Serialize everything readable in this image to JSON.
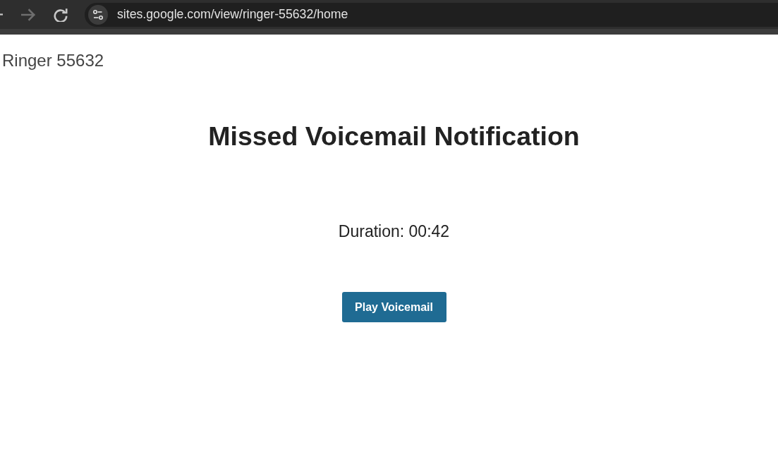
{
  "browser": {
    "nav_buttons": [
      {
        "kind": "back",
        "disabled": false
      },
      {
        "kind": "forward",
        "disabled": true
      },
      {
        "kind": "reload",
        "disabled": false
      }
    ],
    "address": "sites.google.com/view/ringer-55632/home"
  },
  "site": {
    "title": "Ringer 55632"
  },
  "main": {
    "heading": "Missed Voicemail Notification",
    "duration": "Duration: 00:42",
    "button": "Play Voicemail"
  }
}
